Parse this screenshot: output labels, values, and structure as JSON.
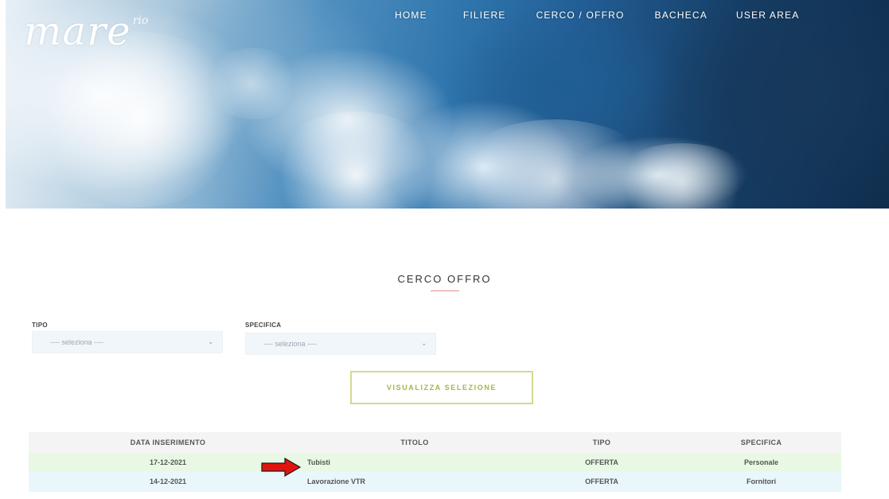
{
  "header": {
    "logo_text": "mare",
    "logo_sup": "rio",
    "nav": [
      {
        "label": "HOME"
      },
      {
        "label": "FILIERE"
      },
      {
        "label": "CERCO / OFFRO"
      },
      {
        "label": "BACHECA"
      },
      {
        "label": "USER AREA"
      }
    ]
  },
  "section": {
    "title": "CERCO OFFRO"
  },
  "filters": {
    "tipo": {
      "label": "TIPO",
      "value": "---- seleziona ----"
    },
    "specifica": {
      "label": "SPECIFICA",
      "value": "---- seleziona ----"
    },
    "button_label": "VISUALIZZA SELEZIONE"
  },
  "table": {
    "headers": [
      "DATA INSERIMENTO",
      "TITOLO",
      "TIPO",
      "SPECIFICA"
    ],
    "rows": [
      {
        "data": "17-12-2021",
        "titolo": "Tubisti",
        "tipo": "OFFERTA",
        "specifica": "Personale"
      },
      {
        "data": "14-12-2021",
        "titolo": "Lavorazione VTR",
        "tipo": "OFFERTA",
        "specifica": "Fornitori"
      }
    ]
  },
  "colors": {
    "arrow": "#e0140f",
    "accent_button": "#a9b34a",
    "row_highlight": "#e8f8e4",
    "row_alt": "#e9f6fb"
  },
  "icons": {
    "select_chevron": "chevron-down-icon",
    "pointer": "red-arrow-icon"
  }
}
